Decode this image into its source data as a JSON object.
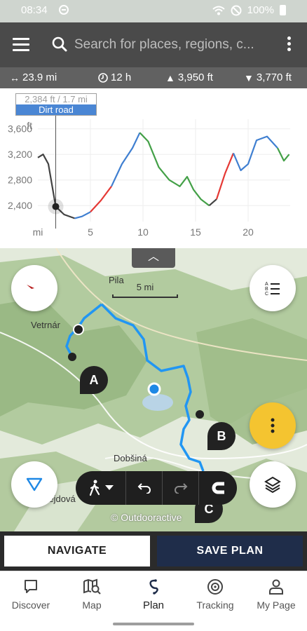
{
  "status_bar": {
    "time": "08:34",
    "battery": "100%"
  },
  "toolbar": {
    "search_placeholder": "Search for places, regions, c..."
  },
  "stats": {
    "distance": "23.9 mi",
    "duration": "12 h",
    "ascent": "3,950 ft",
    "descent": "3,770 ft"
  },
  "chart_data": {
    "type": "line",
    "xlabel": "mi",
    "ylabel": "ft",
    "x_ticks": [
      "mi",
      "5",
      "10",
      "15",
      "20"
    ],
    "y_ticks": [
      "3,600",
      "3,200",
      "2,800",
      "2,400"
    ],
    "xlim": [
      0,
      24
    ],
    "ylim": [
      2150,
      3750
    ],
    "tooltip": {
      "value": "2,384 ft / 1.7 mi",
      "surface": "Dirt road"
    },
    "colors": {
      "asphalt": "#3f7fd1",
      "trail": "#43a047",
      "road": "#e53935",
      "other": "#424242"
    },
    "series": [
      {
        "points": [
          [
            0,
            3150
          ],
          [
            0.5,
            3200
          ],
          [
            1,
            3050
          ],
          [
            1.7,
            2384
          ],
          [
            2.5,
            2260
          ],
          [
            3.5,
            2200
          ]
        ],
        "color": "#424242"
      },
      {
        "points": [
          [
            3.5,
            2200
          ],
          [
            4.2,
            2230
          ],
          [
            5,
            2300
          ]
        ],
        "color": "#3f7fd1"
      },
      {
        "points": [
          [
            5,
            2300
          ],
          [
            6,
            2480
          ],
          [
            7,
            2700
          ]
        ],
        "color": "#e53935"
      },
      {
        "points": [
          [
            7,
            2700
          ],
          [
            8,
            3050
          ],
          [
            9,
            3300
          ],
          [
            9.7,
            3540
          ]
        ],
        "color": "#3f7fd1"
      },
      {
        "points": [
          [
            9.7,
            3540
          ],
          [
            10.5,
            3400
          ],
          [
            11.5,
            3000
          ],
          [
            12.5,
            2800
          ],
          [
            13.5,
            2700
          ],
          [
            14.2,
            2850
          ],
          [
            14.8,
            2650
          ],
          [
            15.5,
            2500
          ],
          [
            16.3,
            2400
          ]
        ],
        "color": "#43a047"
      },
      {
        "points": [
          [
            16.3,
            2400
          ],
          [
            17,
            2500
          ]
        ],
        "color": "#424242"
      },
      {
        "points": [
          [
            17,
            2500
          ],
          [
            17.8,
            2900
          ],
          [
            18.6,
            3220
          ]
        ],
        "color": "#e53935"
      },
      {
        "points": [
          [
            18.6,
            3220
          ],
          [
            19.3,
            2950
          ],
          [
            20,
            3050
          ],
          [
            20.8,
            3420
          ],
          [
            21.8,
            3480
          ],
          [
            22.8,
            3300
          ]
        ],
        "color": "#3f7fd1"
      },
      {
        "points": [
          [
            22.8,
            3300
          ],
          [
            23.4,
            3100
          ],
          [
            23.9,
            3200
          ]
        ],
        "color": "#43a047"
      }
    ]
  },
  "map": {
    "places": [
      "Pila",
      "Vetrnár",
      "Dobšiná",
      "Rejdová"
    ],
    "scale": "5 mi",
    "markers": [
      "A",
      "B",
      "C"
    ],
    "copyright": "© Outdooractive",
    "collapse_icon": "chevron-up-icon",
    "compass_icon": "compass-icon"
  },
  "actions": {
    "navigate": "NAVIGATE",
    "save": "SAVE PLAN"
  },
  "bottom_nav": [
    {
      "label": "Discover",
      "icon": "chat-bubble-icon"
    },
    {
      "label": "Map",
      "icon": "map-search-icon"
    },
    {
      "label": "Plan",
      "icon": "route-icon"
    },
    {
      "label": "Tracking",
      "icon": "target-icon"
    },
    {
      "label": "My Page",
      "icon": "person-icon"
    }
  ]
}
